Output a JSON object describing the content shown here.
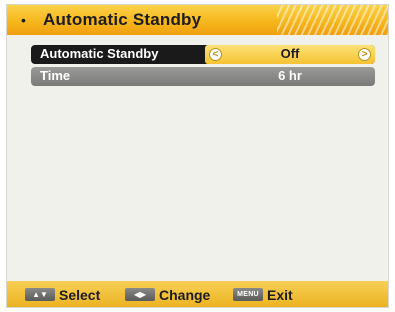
{
  "menu": {
    "title": "Automatic Standby",
    "bullet": "•"
  },
  "rows": [
    {
      "label": "Automatic Standby",
      "value": "Off",
      "left_arrow": "<",
      "right_arrow": ">",
      "selected": true
    },
    {
      "label": "Time",
      "value": "6 hr",
      "selected": false
    }
  ],
  "footer": {
    "select_key": "▲▼",
    "select_label": "Select",
    "change_key": "◀▶",
    "change_label": "Change",
    "menu_key": "MENU",
    "exit_label": "Exit"
  },
  "colors": {
    "title_bar": "#f6b71c",
    "selected_row": "#1a1a1a",
    "value_box": "#f5c232",
    "inactive_row": "#8a8a88",
    "footer": "#ecb322",
    "screen_bg": "#f1f1ec"
  }
}
